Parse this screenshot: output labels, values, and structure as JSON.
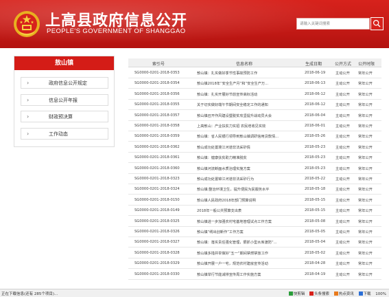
{
  "header": {
    "title": "上高县政府信息公开",
    "subtitle": "PEOPLE'S GOVERNMENT OF SHANGGAO",
    "search_placeholder": "请输入关键词搜索",
    "accent_color": "#d7221c"
  },
  "sidebar": {
    "heading": "敖山镇",
    "items": [
      {
        "label": "政府信息公开规定"
      },
      {
        "label": "信息公开年报"
      },
      {
        "label": "财政预决算"
      },
      {
        "label": "工作动态"
      }
    ]
  },
  "table": {
    "headers": {
      "id": "索引号",
      "name": "信息名称",
      "date": "生成日期",
      "mode": "公开方式",
      "term": "公开时限"
    },
    "rows": [
      {
        "id": "SG0000-0201-2018-0353",
        "name": "敖山镇：扎实做好季节性事故预防工作",
        "date": "2018-06-19",
        "mode": "主动公开",
        "term": "常年公开"
      },
      {
        "id": "SG0000-0201-2018-0354",
        "name": "敖山镇2018年“安全生产月”和“安全生产万...",
        "date": "2018-06-13",
        "mode": "主动公开",
        "term": "常年公开"
      },
      {
        "id": "SG0000-0201-2018-0356",
        "name": "敖山镇：扎实开展好节前宣传高标活动",
        "date": "2018-06-12",
        "mode": "主动公开",
        "term": "常年公开"
      },
      {
        "id": "SG0000-0201-2018-0355",
        "name": "关于切实做好端午节期间安全稳定工作的通知",
        "date": "2018-06-12",
        "mode": "主动公开",
        "term": "常年公开"
      },
      {
        "id": "SG0000-0201-2018-0357",
        "name": "敖山镇召开作风建设暨脱贫攻坚提升战动员大会",
        "date": "2018-06-04",
        "mode": "主动公开",
        "term": "常年公开"
      },
      {
        "id": "SG0000-0201-2018-0358",
        "name": "上高敖山：产业扶贫力实招 农民增收见实效",
        "date": "2018-06-01",
        "mode": "主动公开",
        "term": "常年公开"
      },
      {
        "id": "SG0000-0201-2018-0359",
        "name": "敖山镇：省人民银行领导到敖山镇调研信用贷款情...",
        "date": "2018-05-26",
        "mode": "主动公开",
        "term": "常年公开"
      },
      {
        "id": "SG0000-0201-2018-0362",
        "name": "敖山成功处置境江河道非法采砂情",
        "date": "2018-05-23",
        "mode": "主动公开",
        "term": "常年公开"
      },
      {
        "id": "SG0000-0201-2018-0361",
        "name": "敖山镇：健康扶贫助力精准脱贫",
        "date": "2018-05-23",
        "mode": "主动公开",
        "term": "常年公开"
      },
      {
        "id": "SG0000-0201-2018-0360",
        "name": "敖山镇河流断面水质治理实施方案",
        "date": "2018-05-23",
        "mode": "主动公开",
        "term": "常年公开"
      },
      {
        "id": "SG0000-0201-2018-0323",
        "name": "敖山成功处置锦江河道非法采砂行为",
        "date": "2018-05-22",
        "mode": "主动公开",
        "term": "常年公开"
      },
      {
        "id": "SG0000-0201-2018-0324",
        "name": "敖山镇:整治环境卫生，提升便民为民服务水平",
        "date": "2018-05-18",
        "mode": "主动公开",
        "term": "常年公开"
      },
      {
        "id": "SG0000-0201-2018-0150",
        "name": "敖山镇人民政府2018年部门预算说明",
        "date": "2018-05-15",
        "mode": "主动公开",
        "term": "常年公开"
      },
      {
        "id": "SG0000-0201-2018-0149",
        "name": "2018年一般公共预算支出表",
        "date": "2018-05-15",
        "mode": "主动公开",
        "term": "常年公开"
      },
      {
        "id": "SG0000-0201-2018-0325",
        "name": "敖山镇进一步加强农村宅基地管理试点工作方案",
        "date": "2018-05-08",
        "mode": "主动公开",
        "term": "常年公开"
      },
      {
        "id": "SG0000-0201-2018-0326",
        "name": "敖山镇“绣出创新作”工作方案",
        "date": "2018-05-05",
        "mode": "主动公开",
        "term": "常年公开"
      },
      {
        "id": "SG0000-0201-2018-0327",
        "name": "敖山镇：落实责任强化管理，狠抓小型水库渡防“...",
        "date": "2018-05-04",
        "mode": "主动公开",
        "term": "常年公开"
      },
      {
        "id": "SG0000-0201-2018-0328",
        "name": "敖山镇多措并举做好“五一”期间禁燃禁放工作",
        "date": "2018-05-02",
        "mode": "主动公开",
        "term": "常年公开"
      },
      {
        "id": "SG0000-0201-2018-0329",
        "name": "敖山镇开展一户一宅，规范农村建房宣传活动",
        "date": "2018-04-28",
        "mode": "主动公开",
        "term": "常年公开"
      },
      {
        "id": "SG0000-0201-2018-0330",
        "name": "敖山镇举行节能减排宣传周工作实施方案",
        "date": "2018-04-19",
        "mode": "主动公开",
        "term": "常年公开"
      }
    ]
  },
  "statusbar": {
    "left": "正在下载信息(还有 285个项目)...",
    "right_items": [
      "快剪辑",
      "头条搜索",
      "热点资讯",
      "下载",
      "100%"
    ]
  }
}
